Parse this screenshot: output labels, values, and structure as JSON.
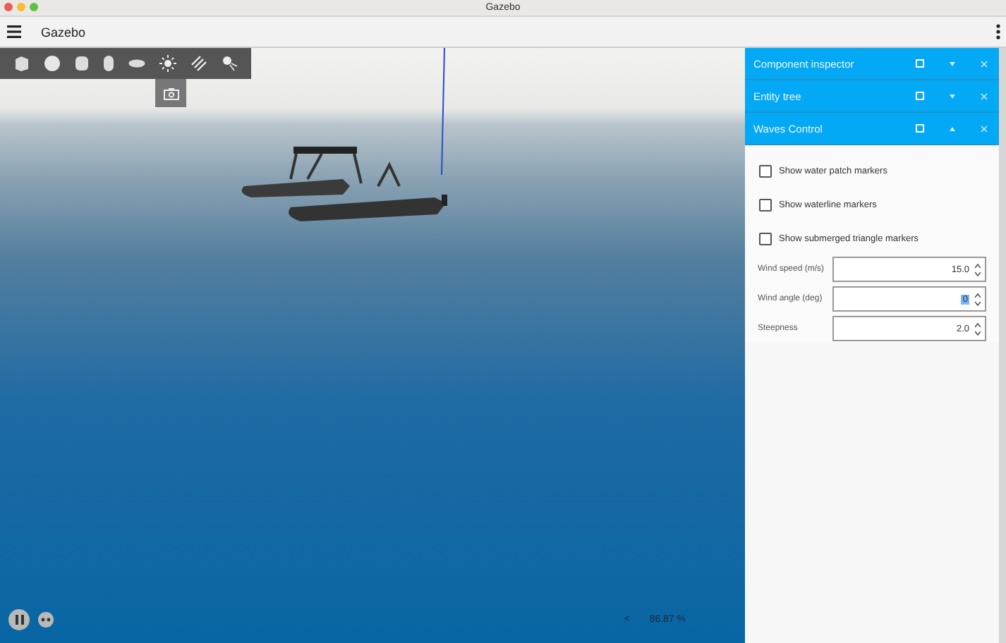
{
  "window": {
    "title": "Gazebo"
  },
  "app_bar": {
    "title": "Gazebo"
  },
  "panels": [
    {
      "title": "Component inspector",
      "expanded": false
    },
    {
      "title": "Entity tree",
      "expanded": false
    },
    {
      "title": "Waves Control",
      "expanded": true
    }
  ],
  "waves_control": {
    "checkboxes": [
      {
        "label": "Show water patch markers",
        "checked": false
      },
      {
        "label": "Show waterline markers",
        "checked": false
      },
      {
        "label": "Show submerged triangle markers",
        "checked": false
      }
    ],
    "fields": [
      {
        "label": "Wind speed (m/s)",
        "value": "15.0",
        "selected": false
      },
      {
        "label": "Wind angle (deg)",
        "value": "0",
        "selected": true
      },
      {
        "label": "Steepness",
        "value": "2.0",
        "selected": false
      }
    ]
  },
  "status": {
    "arrow": "<",
    "rtf": "86.87 %"
  }
}
